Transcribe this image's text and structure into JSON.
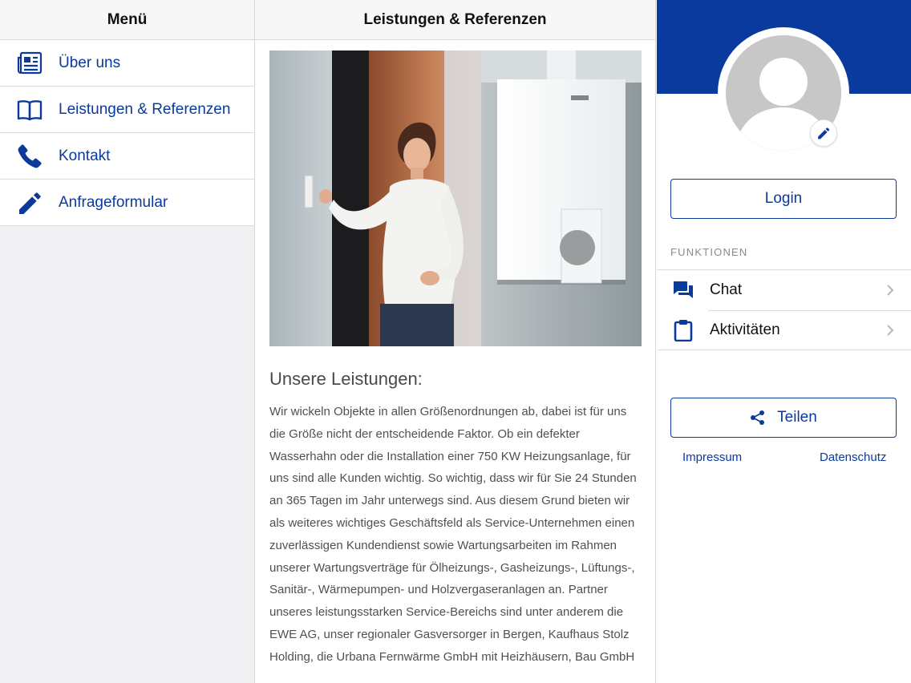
{
  "menu": {
    "title": "Menü",
    "items": [
      {
        "label": "Über uns",
        "icon": "newspaper-icon"
      },
      {
        "label": "Leistungen & Referenzen",
        "icon": "book-icon"
      },
      {
        "label": "Kontakt",
        "icon": "phone-icon"
      },
      {
        "label": "Anfrageformular",
        "icon": "pencil-icon"
      }
    ]
  },
  "content": {
    "title": "Leistungen & Referenzen",
    "heading": "Unsere Leistungen:",
    "body": "Wir wickeln Objekte in allen Größenordnungen ab, dabei ist für uns die Größe nicht der entscheidende Faktor. Ob ein defekter Wasserhahn oder die Installation einer 750 KW Heizungsanlage, für uns sind alle Kunden wichtig. So wichtig, dass wir für Sie 24 Stunden an 365 Tagen im Jahr unterwegs sind. Aus diesem Grund bieten wir als weiteres wichtiges Geschäftsfeld als Service-Unternehmen einen zuverlässigen Kundendienst sowie Wartungsarbeiten im Rahmen unserer Wartungsverträge für Ölheizungs-, Gasheizungs-, Lüftungs-, Sanitär-, Wärmepumpen- und Holzvergaseranlagen an. Partner unseres leistungsstarken Service-Bereichs sind unter anderem die EWE AG, unser regionaler Gasversorger in Bergen, Kaufhaus Stolz Holding, die Urbana Fernwärme GmbH mit Heizhäusern, Bau GmbH"
  },
  "profile": {
    "login_label": "Login",
    "section_label": "FUNKTIONEN",
    "functions": [
      {
        "label": "Chat",
        "icon": "chat-icon"
      },
      {
        "label": "Aktivitäten",
        "icon": "clipboard-icon"
      }
    ],
    "share_label": "Teilen",
    "impressum": "Impressum",
    "datenschutz": "Datenschutz"
  },
  "colors": {
    "brand_blue": "#0a3a9e",
    "link_blue": "#0b3a9c"
  }
}
